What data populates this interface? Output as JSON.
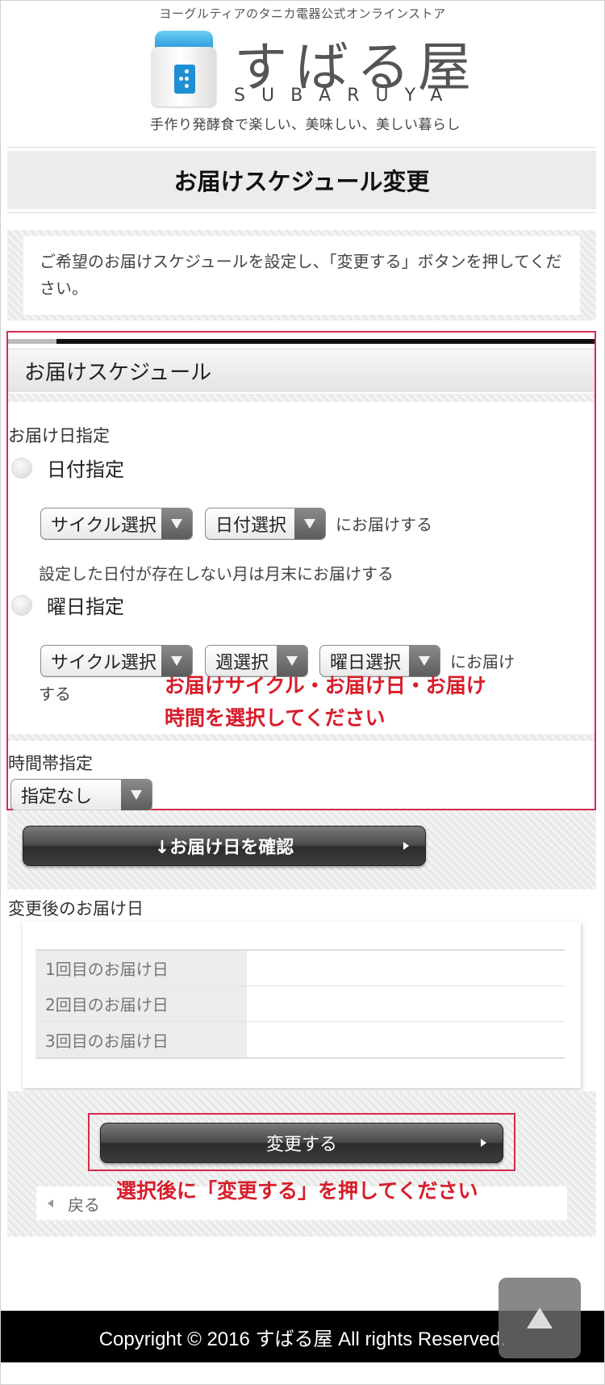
{
  "header": {
    "tagline": "ヨーグルティアのタニカ電器公式オンラインストア",
    "logo_name": "すばる屋",
    "logo_roman": "SUBARUYA",
    "slogan": "手作り発酵食で楽しい、美味しい、美しい暮らし"
  },
  "page_title": "お届けスケジュール変更",
  "intro_text": "ご希望のお届けスケジュールを設定し、「変更する」ボタンを押してください。",
  "schedule": {
    "heading": "お届けスケジュール",
    "delivery_day_label": "お届け日指定",
    "option_date": {
      "label": "日付指定",
      "cycle_select": "サイクル選択",
      "date_select": "日付選択",
      "suffix": "にお届けする",
      "note": "設定した日付が存在しない月は月末にお届けする"
    },
    "option_weekday": {
      "label": "曜日指定",
      "cycle_select": "サイクル選択",
      "week_select": "週選択",
      "weekday_select": "曜日選択",
      "suffix_line1": "にお届け",
      "suffix_line2": "する"
    },
    "annotation_line1": "お届けサイクル・お届け日・お届け",
    "annotation_line2": "時間を選択してください",
    "time_label": "時間帯指定",
    "time_select": "指定なし"
  },
  "confirm_button": "↓お届け日を確認",
  "after_label": "変更後のお届け日",
  "dates": [
    {
      "label": "1回目のお届け日",
      "value": ""
    },
    {
      "label": "2回目のお届け日",
      "value": ""
    },
    {
      "label": "3回目のお届け日",
      "value": ""
    }
  ],
  "change_button": "変更する",
  "change_annotation": "選択後に「変更する」を押してください",
  "back_link": "戻る",
  "footer": "Copyright © 2016 すばる屋 All rights Reserved.",
  "colors": {
    "annotation_red": "#d81d2b",
    "highlight_border": "#d42b4d",
    "logo_blue": "#1f8fd4"
  },
  "icons": {
    "scroll_top": "up-triangle-icon",
    "select_arrow": "chevron-down-icon",
    "button_arrow": "right-triangle-icon",
    "back_arrow": "left-triangle-icon"
  }
}
